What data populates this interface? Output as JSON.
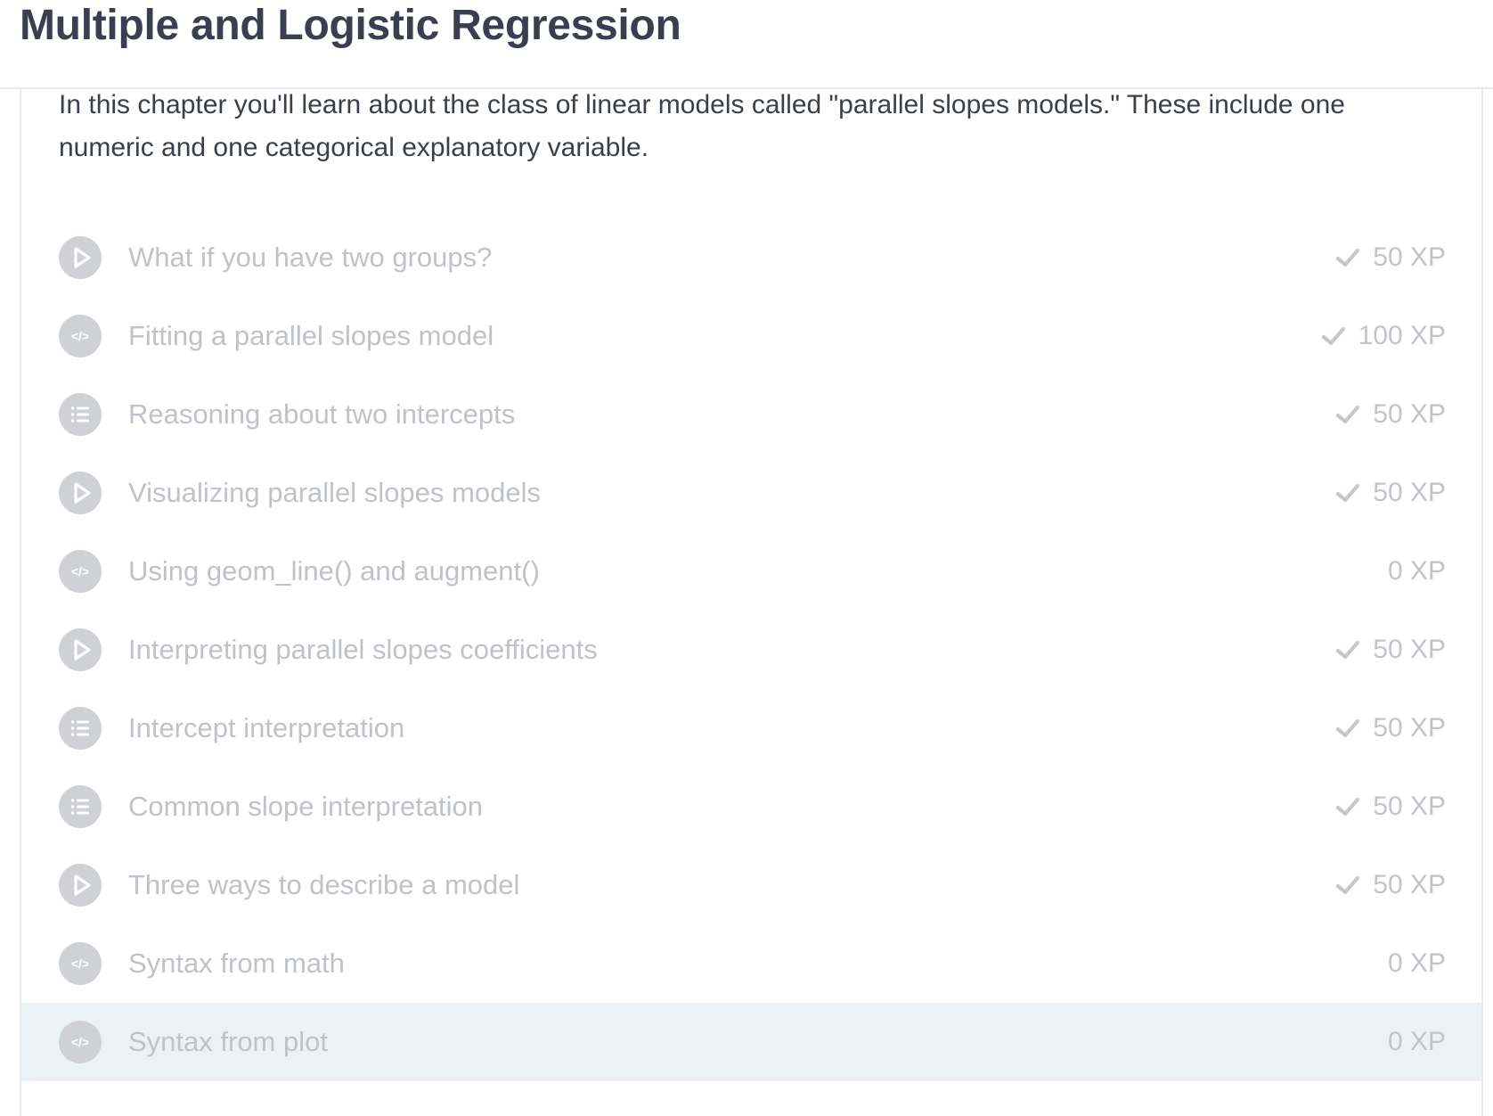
{
  "header": {
    "title": "Multiple and Logistic Regression"
  },
  "chapter": {
    "description": "In this chapter you'll learn about the class of linear models called \"parallel slopes models.\" These include one numeric and one categorical explanatory variable."
  },
  "exercises": [
    {
      "title": "What if you have two groups?",
      "type_icon": "video-icon",
      "completed": true,
      "xp": "50 XP"
    },
    {
      "title": "Fitting a parallel slopes model",
      "type_icon": "code-icon",
      "completed": true,
      "xp": "100 XP"
    },
    {
      "title": "Reasoning about two intercepts",
      "type_icon": "multiple-choice-icon",
      "completed": true,
      "xp": "50 XP"
    },
    {
      "title": "Visualizing parallel slopes models",
      "type_icon": "video-icon",
      "completed": true,
      "xp": "50 XP"
    },
    {
      "title": "Using geom_line() and augment()",
      "type_icon": "code-icon",
      "completed": false,
      "xp": "0 XP"
    },
    {
      "title": "Interpreting parallel slopes coefficients",
      "type_icon": "video-icon",
      "completed": true,
      "xp": "50 XP"
    },
    {
      "title": "Intercept interpretation",
      "type_icon": "multiple-choice-icon",
      "completed": true,
      "xp": "50 XP"
    },
    {
      "title": "Common slope interpretation",
      "type_icon": "multiple-choice-icon",
      "completed": true,
      "xp": "50 XP"
    },
    {
      "title": "Three ways to describe a model",
      "type_icon": "video-icon",
      "completed": true,
      "xp": "50 XP"
    },
    {
      "title": "Syntax from math",
      "type_icon": "code-icon",
      "completed": false,
      "xp": "0 XP"
    },
    {
      "title": "Syntax from plot",
      "type_icon": "code-icon",
      "completed": false,
      "xp": "0 XP",
      "active": true
    }
  ],
  "colors": {
    "title_text": "#3a3e4f",
    "body_text": "#3b3f4c",
    "muted_text": "#bfc2c8",
    "icon_circle": "#cfd1d5",
    "active_row": "#ebf2f6"
  }
}
